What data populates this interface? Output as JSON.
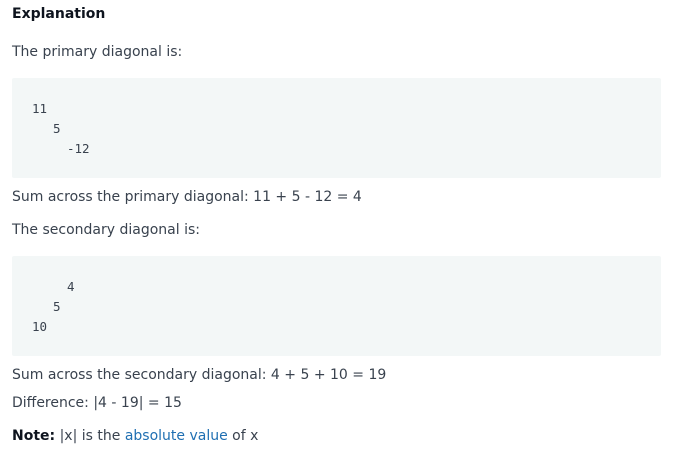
{
  "heading": "Explanation",
  "primary_intro": "The primary diagonal is:",
  "primary_code": [
    "11",
    "5",
    "-12"
  ],
  "primary_sum": "Sum across the primary diagonal: 11 + 5 - 12 = 4",
  "secondary_intro": "The secondary diagonal is:",
  "secondary_code": [
    "4",
    "5",
    "10"
  ],
  "secondary_sum": "Sum across the secondary diagonal: 4 + 5 + 10 = 19",
  "difference": "Difference: |4 - 19| = 15",
  "note": {
    "label": "Note:",
    "text_before": " |x| is the ",
    "link_text": "absolute value",
    "text_after": " of x"
  },
  "colors": {
    "text": "#39424e",
    "heading": "#0e141e",
    "code_bg": "#f3f7f7",
    "link": "#1f6fb2"
  }
}
